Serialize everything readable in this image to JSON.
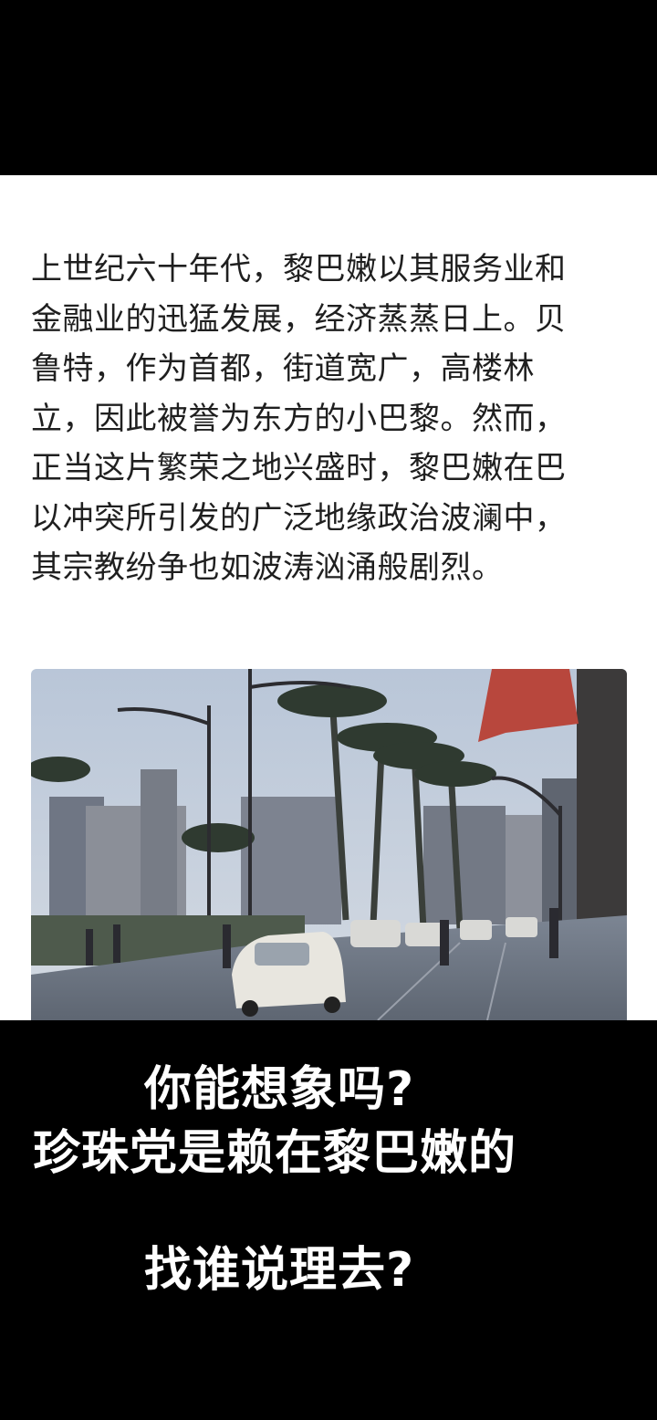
{
  "article": {
    "lines": [
      "上世纪六十年代，黎巴嫩以其服务业和",
      "金融业的迅猛发展，经济蒸蒸日上。贝",
      "鲁特，作为首都，街道宽广，高楼林",
      "立，因此被誉为东方的小巴黎。然而，",
      "正当这片繁荣之地兴盛时，黎巴嫩在巴",
      "以冲突所引发的广泛地缘政治波澜中，",
      "其宗教纷争也如波涛汹涌般剧烈。"
    ]
  },
  "photo": {
    "subject": "street-photo"
  },
  "captions": {
    "line1": "你能想象吗?",
    "line2": "珍珠党是赖在黎巴嫩的",
    "line3": "找谁说理去?"
  },
  "colors": {
    "background": "#000000",
    "article_bg": "#ffffff",
    "text": "#1f1f1f",
    "caption": "#ffffff"
  }
}
